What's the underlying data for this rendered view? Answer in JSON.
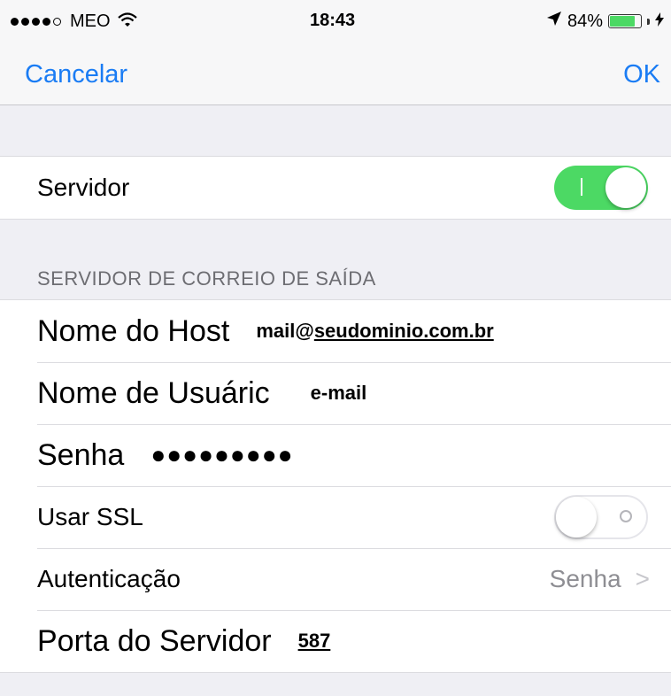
{
  "status_bar": {
    "carrier": "MEO",
    "time": "18:43",
    "battery": "84%",
    "battery_level": 0.84,
    "signal_bars": 4,
    "signal_total": 5
  },
  "nav": {
    "cancel_label": "Cancelar",
    "ok_label": "OK"
  },
  "server_group": {
    "label": "Servidor",
    "enabled": true
  },
  "outgoing": {
    "section_header": "SERVIDOR DE CORREIO DE SAÍDA",
    "host_label": "Nome do Host",
    "host_value_prefix": "mail@",
    "host_value_domain": "seudominio.com.br",
    "username_label": "Nome de Usuáric",
    "username_value": "e-mail",
    "password_label": "Senha",
    "password_value": "●●●●●●●●●",
    "ssl_label": "Usar SSL",
    "ssl_enabled": false,
    "auth_label": "Autenticação",
    "auth_value": "Senha",
    "port_label": "Porta do Servidor",
    "port_value": "587"
  },
  "colors": {
    "accent": "#1a7cf4",
    "toggle_on": "#4cd964",
    "background": "#efeff4"
  },
  "icons": [
    "wifi-icon",
    "location-arrow-icon",
    "battery-icon",
    "chevron-right-icon"
  ]
}
